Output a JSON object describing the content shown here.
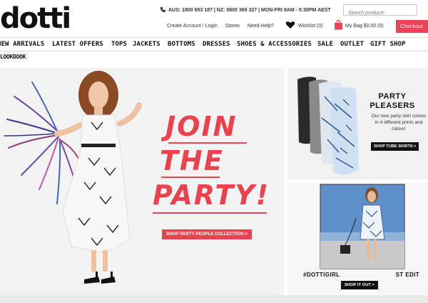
{
  "brand": {
    "logo_text": "dotti",
    "logo_tm": "TM"
  },
  "header": {
    "contact": "AUS: 1800 653 187 | NZ: 0800 369 327 | MON-FRI 9AM - 5:30PM AEST",
    "search_placeholder": "Search products",
    "links": [
      "Create Account / Login",
      "Stores",
      "Need Help?"
    ],
    "wishlist": "Wishlist  (0)",
    "bag": "My Bag  $0.00  (0)",
    "checkout": "Checkout"
  },
  "nav": {
    "items": [
      "NEW ARRIVALS",
      "LATEST OFFERS",
      "TOPS",
      "JACKETS",
      "BOTTOMS",
      "DRESSES",
      "SHOES & ACCESSORIES",
      "SALE",
      "OUTLET",
      "GIFT SHOP"
    ],
    "lookbook": "LOOKBOOK"
  },
  "hero": {
    "line1": "JOIN",
    "line2": "THE",
    "line3": "PARTY!",
    "cta": "SHOP PARTY PEOPLE COLLECTION  >"
  },
  "promo1": {
    "title_line1": "PARTY",
    "title_line2": "PLEASERS",
    "text": "Our new party skirt comes in 4 different prints and colour!",
    "cta": "SHOP TUBE SKIRTS  >"
  },
  "promo2": {
    "title": "#DOTTIGIRL",
    "title_rest": "ST EDIT",
    "cta": "SHOP IT OUT  >"
  },
  "colors": {
    "accent": "#e8434f",
    "checkout": "#e8455a",
    "dark": "#111111"
  }
}
